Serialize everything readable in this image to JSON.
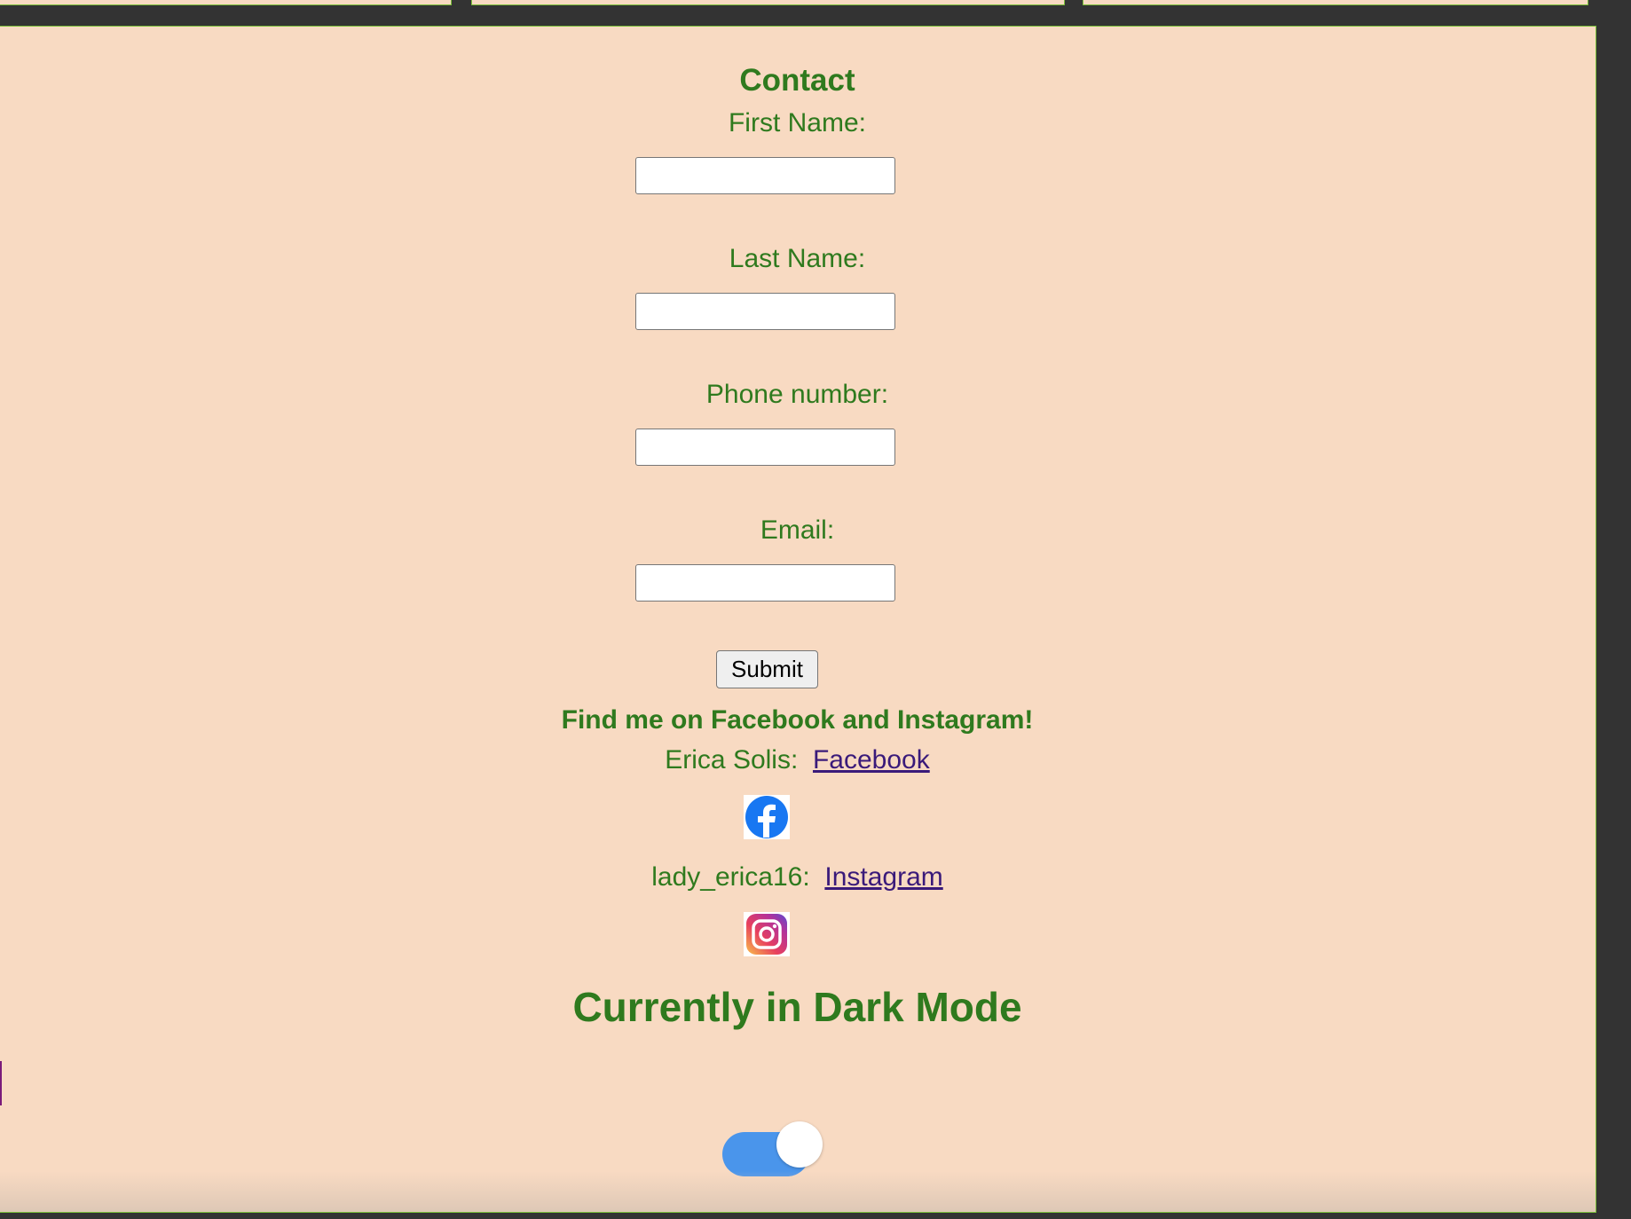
{
  "contact": {
    "title": "Contact",
    "first_name_label": "First Name:",
    "first_name_value": "",
    "last_name_label": "Last Name:",
    "last_name_value": "",
    "phone_label": "Phone number:",
    "phone_value": "",
    "email_label": "Email:",
    "email_value": "",
    "submit_label": "Submit"
  },
  "social": {
    "heading": "Find me on Facebook and Instagram!",
    "facebook_name": "Erica Solis:",
    "facebook_link": "Facebook",
    "facebook_icon": "facebook-icon",
    "instagram_name": "lady_erica16:",
    "instagram_link": "Instagram",
    "instagram_icon": "instagram-icon"
  },
  "mode": {
    "heading": "Currently in Dark Mode",
    "toggle_on": true
  },
  "colors": {
    "panel_background": "#f8dac2",
    "text_green": "#2f7a1e",
    "link_purple": "#3a1a7a",
    "toggle_blue": "#4a95eb",
    "page_background": "#333333"
  }
}
